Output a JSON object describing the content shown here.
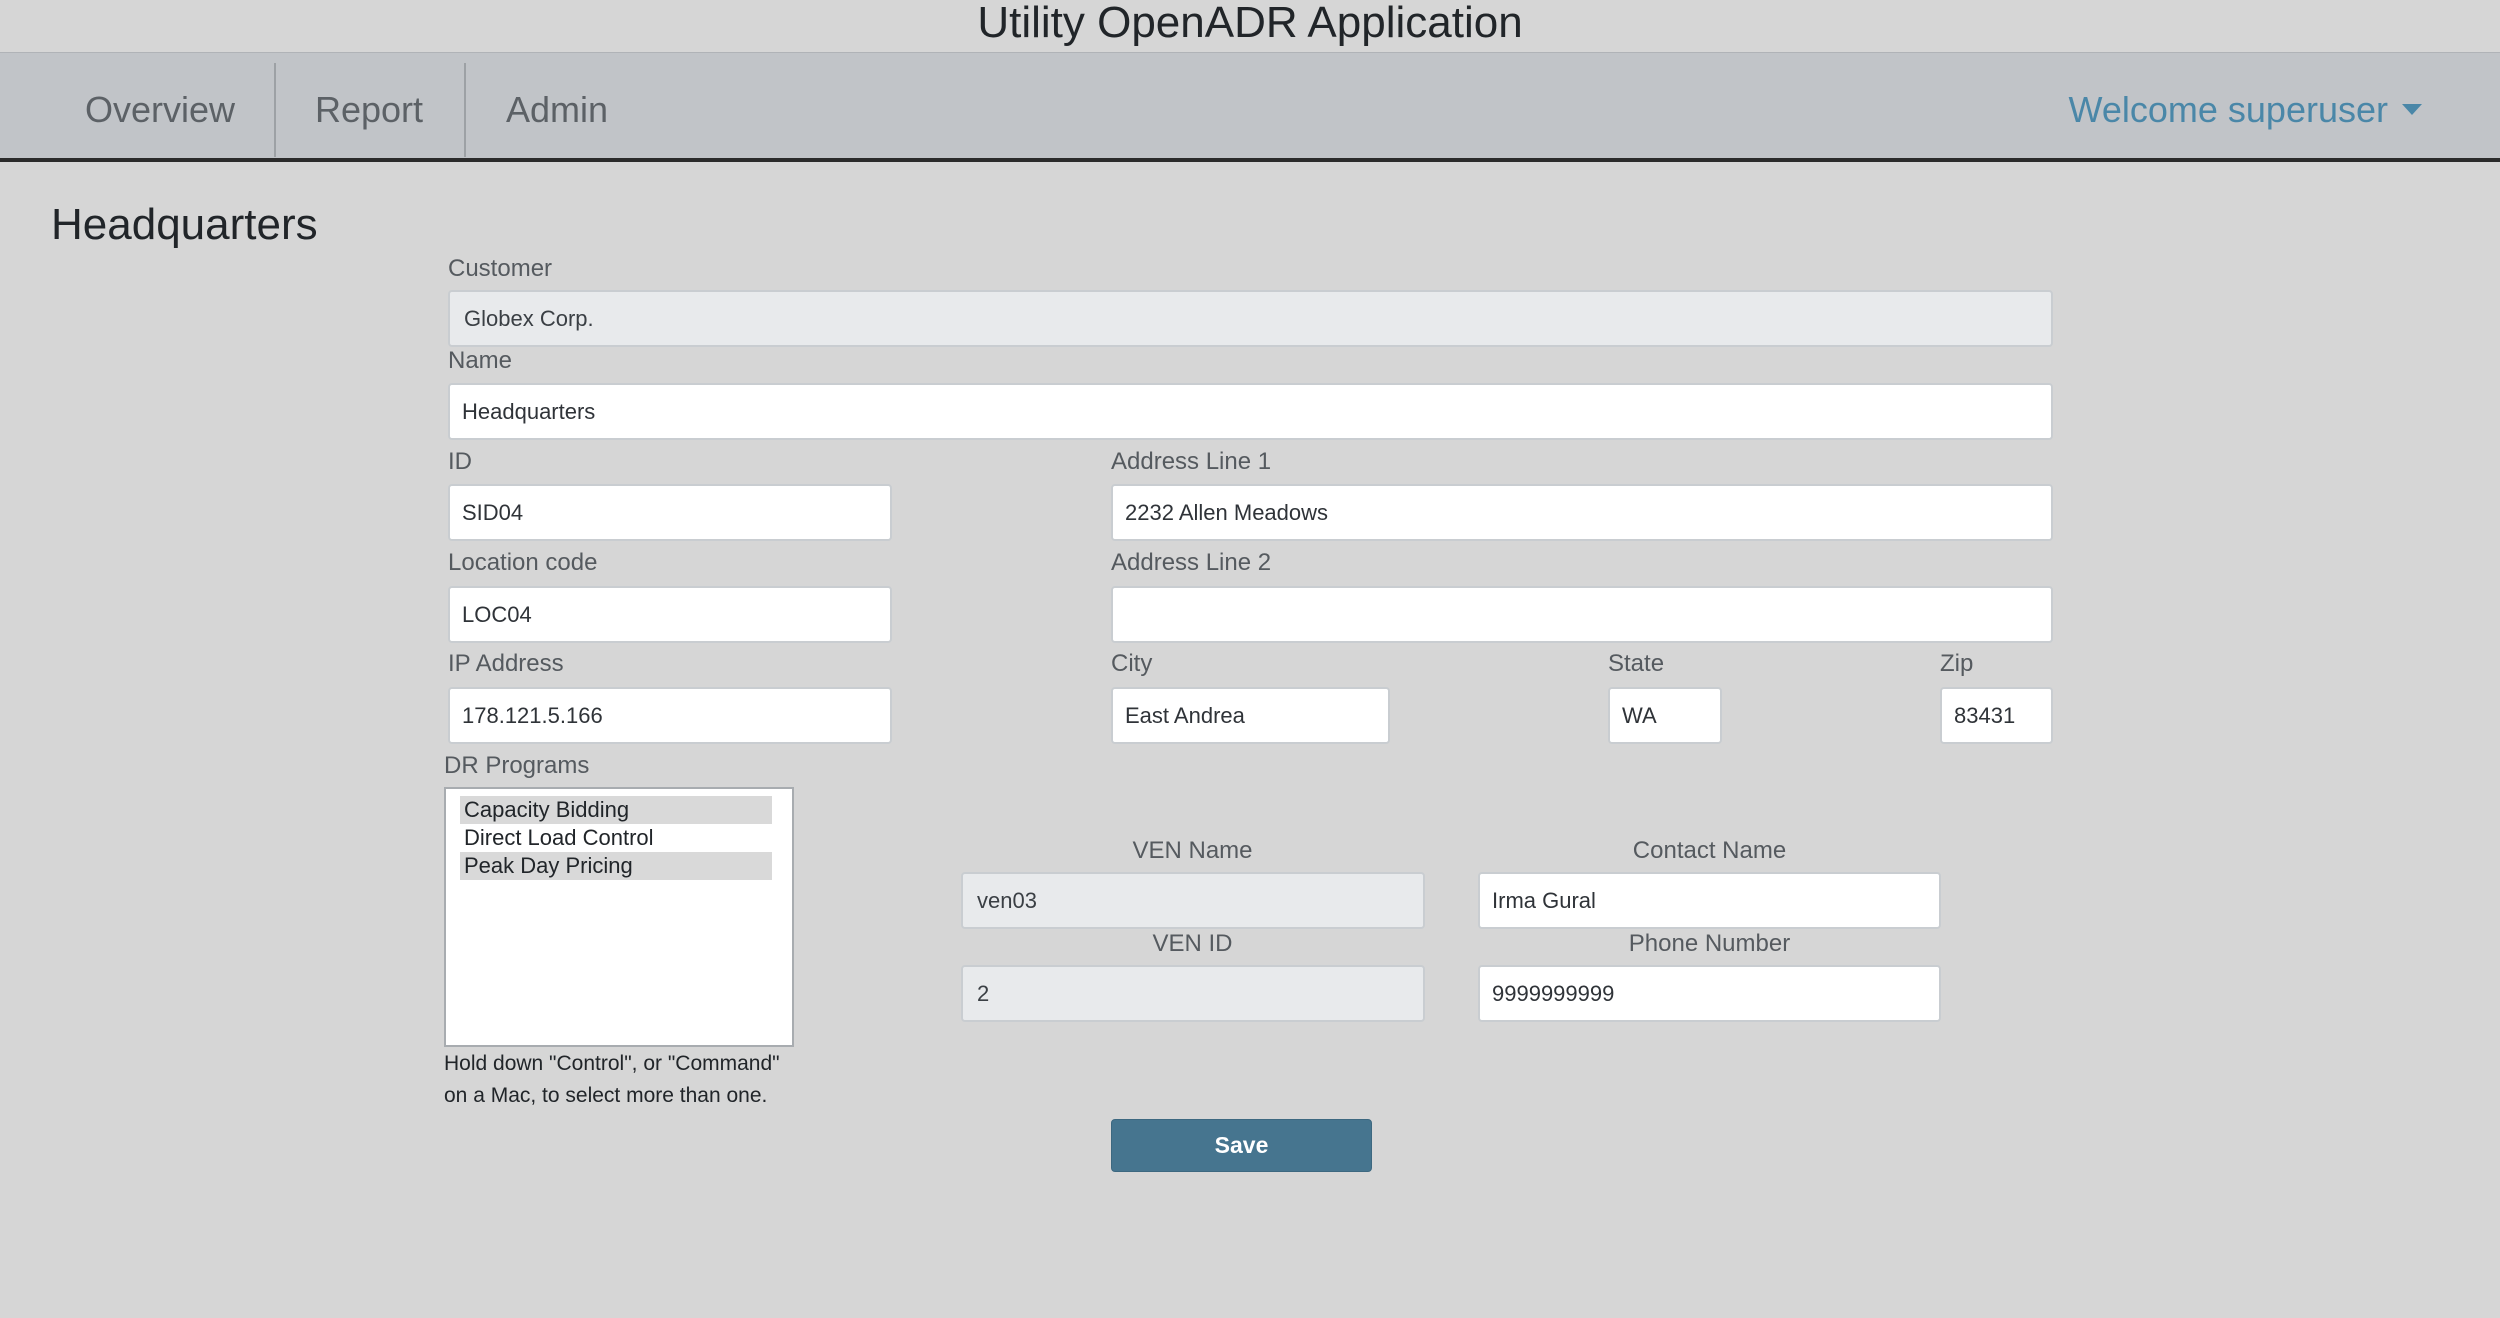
{
  "app": {
    "title": "Utility OpenADR Application"
  },
  "nav": {
    "items": [
      {
        "label": "Overview"
      },
      {
        "label": "Report"
      },
      {
        "label": "Admin"
      }
    ],
    "welcome": "Welcome superuser"
  },
  "page": {
    "heading": "Headquarters"
  },
  "form": {
    "customer": {
      "label": "Customer",
      "value": "Globex Corp."
    },
    "name": {
      "label": "Name",
      "value": "Headquarters"
    },
    "id": {
      "label": "ID",
      "value": "SID04"
    },
    "address1": {
      "label": "Address Line 1",
      "value": "2232 Allen Meadows"
    },
    "location_code": {
      "label": "Location code",
      "value": "LOC04"
    },
    "address2": {
      "label": "Address Line 2",
      "value": ""
    },
    "ip_address": {
      "label": "IP Address",
      "value": "178.121.5.166"
    },
    "city": {
      "label": "City",
      "value": "East Andrea"
    },
    "state": {
      "label": "State",
      "value": "WA"
    },
    "zip": {
      "label": "Zip",
      "value": "83431"
    },
    "dr_programs": {
      "label": "DR Programs",
      "options": [
        {
          "label": "Capacity Bidding",
          "selected": true
        },
        {
          "label": "Direct Load Control",
          "selected": false
        },
        {
          "label": "Peak Day Pricing",
          "selected": true
        }
      ],
      "help_line1": "Hold down \"Control\", or \"Command\"",
      "help_line2": "on a Mac, to select more than one."
    },
    "ven_name": {
      "label": "VEN Name",
      "value": "ven03"
    },
    "ven_id": {
      "label": "VEN ID",
      "value": "2"
    },
    "contact_name": {
      "label": "Contact Name",
      "value": "Irma Gural"
    },
    "phone": {
      "label": "Phone Number",
      "value": "9999999999"
    },
    "save_label": "Save"
  },
  "colors": {
    "background": "#d6d6d6",
    "navbar": "#c1c4c8",
    "accent": "#4a87a8",
    "button": "#46758f"
  }
}
